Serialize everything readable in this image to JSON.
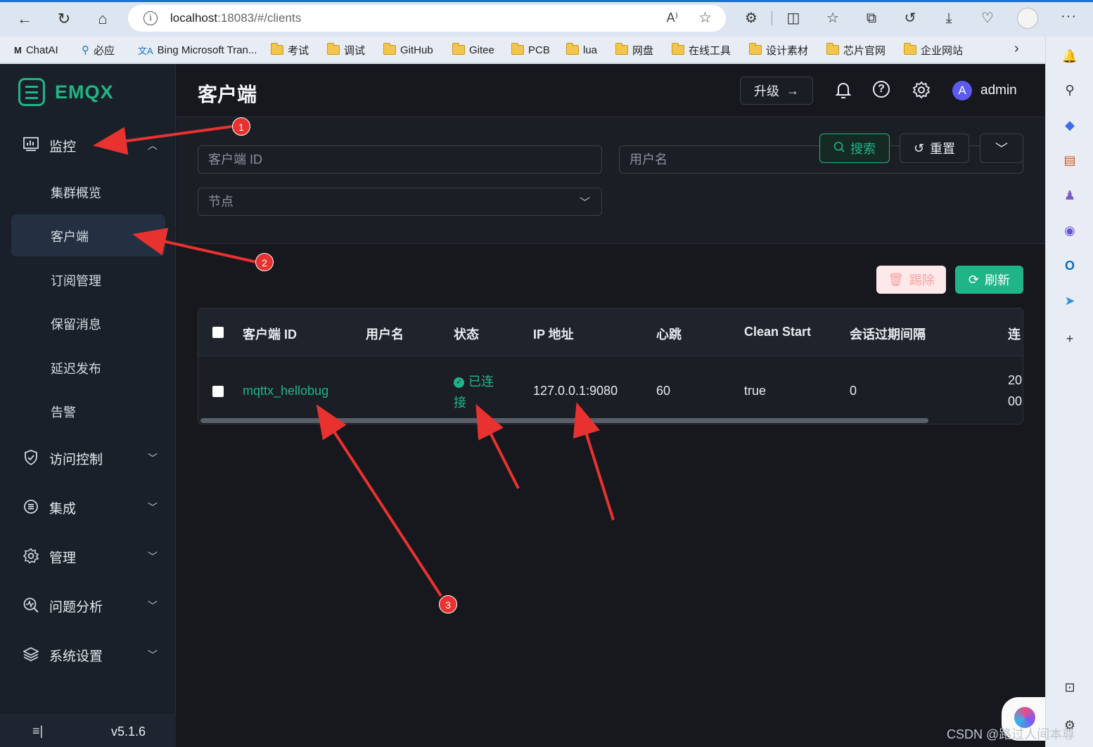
{
  "browser": {
    "url_host": "localhost",
    "url_path": ":18083/#/clients",
    "bookmarks": [
      "ChatAI",
      "必应",
      "Bing Microsoft Tran...",
      "考试",
      "调试",
      "GitHub",
      "Gitee",
      "PCB",
      "lua",
      "网盘",
      "在线工具",
      "设计素材",
      "芯片官网",
      "企业网站"
    ]
  },
  "sidebar": {
    "logo": "EMQX",
    "monitor": "监控",
    "sub_items": [
      "集群概览",
      "客户端",
      "订阅管理",
      "保留消息",
      "延迟发布",
      "告警"
    ],
    "groups": [
      "访问控制",
      "集成",
      "管理",
      "问题分析",
      "系统设置"
    ],
    "version": "v5.1.6"
  },
  "header": {
    "title": "客户端",
    "upgrade": "升级",
    "user": "admin",
    "avatar_letter": "A"
  },
  "filters": {
    "client_id_placeholder": "客户端 ID",
    "username_placeholder": "用户名",
    "node_placeholder": "节点",
    "search": "搜索",
    "reset": "重置"
  },
  "actions": {
    "kick": "踢除",
    "refresh": "刷新"
  },
  "table": {
    "headers": [
      "客户端 ID",
      "用户名",
      "状态",
      "IP 地址",
      "心跳",
      "Clean Start",
      "会话过期间隔",
      "连"
    ],
    "row": {
      "client_id": "mqttx_hellobug",
      "username": "",
      "status": "已连接",
      "ip": "127.0.0.1:9080",
      "keepalive": "60",
      "clean_start": "true",
      "expiry": "0",
      "connected_at_line1": "20",
      "connected_at_line2": "00"
    }
  },
  "annotations": [
    "1",
    "2",
    "3"
  ],
  "watermark": "CSDN @路过人间本尊",
  "colors": {
    "accent": "#1fb587",
    "annotation": "#e8322f",
    "app_bg": "#16181e",
    "sidebar_bg": "#1a2029"
  }
}
